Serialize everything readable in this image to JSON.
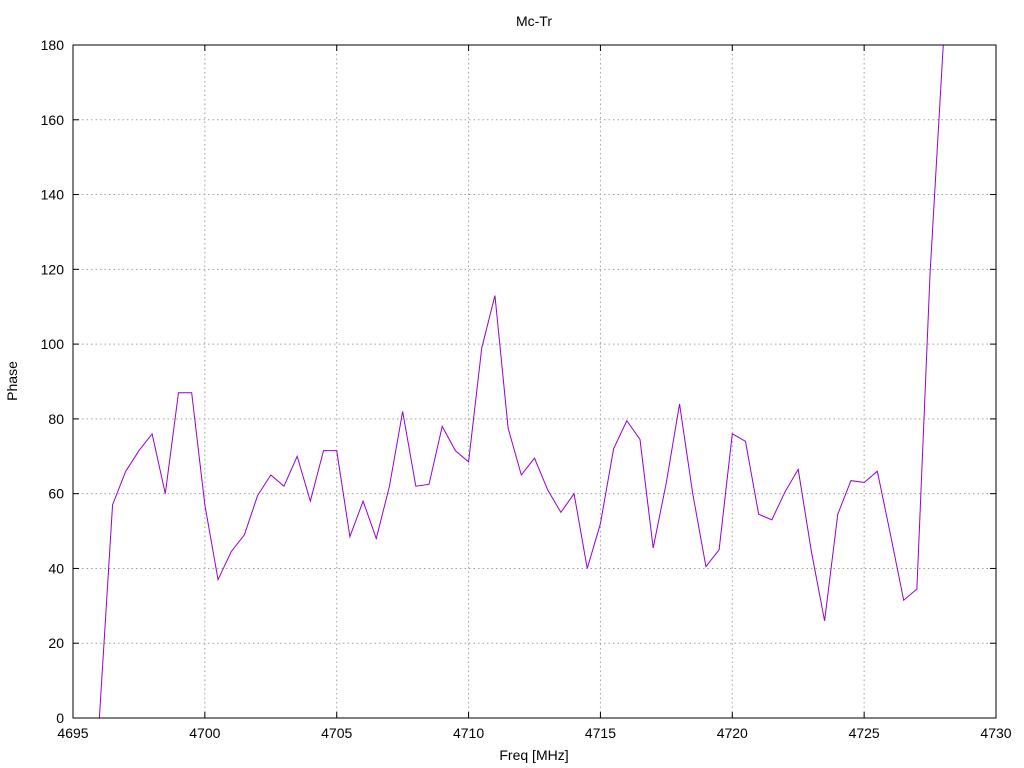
{
  "chart_data": {
    "type": "line",
    "title": "Mc-Tr",
    "xlabel": "Freq [MHz]",
    "ylabel": "Phase",
    "xlim": [
      4695,
      4730
    ],
    "ylim": [
      0,
      180
    ],
    "xticks": [
      4695,
      4700,
      4705,
      4710,
      4715,
      4720,
      4725,
      4730
    ],
    "yticks": [
      0,
      20,
      40,
      60,
      80,
      100,
      120,
      140,
      160,
      180
    ],
    "grid": true,
    "legend": "none",
    "series": [
      {
        "color": "#9400d3",
        "x": [
          4696.0,
          4696.5,
          4697.0,
          4697.5,
          4698.0,
          4698.5,
          4699.0,
          4699.5,
          4700.0,
          4700.5,
          4701.0,
          4701.5,
          4702.0,
          4702.5,
          4703.0,
          4703.5,
          4704.0,
          4704.5,
          4705.0,
          4705.5,
          4706.0,
          4706.5,
          4707.0,
          4707.5,
          4708.0,
          4708.5,
          4709.0,
          4709.5,
          4710.0,
          4710.5,
          4711.0,
          4711.5,
          4712.0,
          4712.5,
          4713.0,
          4713.5,
          4714.0,
          4714.5,
          4715.0,
          4715.5,
          4716.0,
          4716.5,
          4717.0,
          4717.5,
          4718.0,
          4718.5,
          4719.0,
          4719.5,
          4720.0,
          4720.5,
          4721.0,
          4721.5,
          4722.0,
          4722.5,
          4723.0,
          4723.5,
          4724.0,
          4724.5,
          4725.0,
          4725.5,
          4726.0,
          4726.5,
          4727.0,
          4727.5,
          4728.0
        ],
        "y": [
          0,
          57,
          66,
          71.5,
          76,
          60,
          87,
          87,
          57,
          37,
          44.5,
          49,
          59.5,
          65,
          62,
          70,
          58,
          71.5,
          71.5,
          48.5,
          58,
          48,
          62,
          82,
          62,
          62.5,
          78,
          71.5,
          68.5,
          99,
          113,
          77.5,
          65,
          69.5,
          61,
          55,
          60,
          40,
          52,
          72,
          79.5,
          74.5,
          45.5,
          63,
          84,
          60,
          40.5,
          45,
          76,
          74,
          54.5,
          53,
          60.5,
          66.5,
          44.5,
          26,
          54.5,
          63.5,
          63,
          66,
          49,
          31.5,
          34.5,
          119,
          180
        ]
      }
    ]
  }
}
